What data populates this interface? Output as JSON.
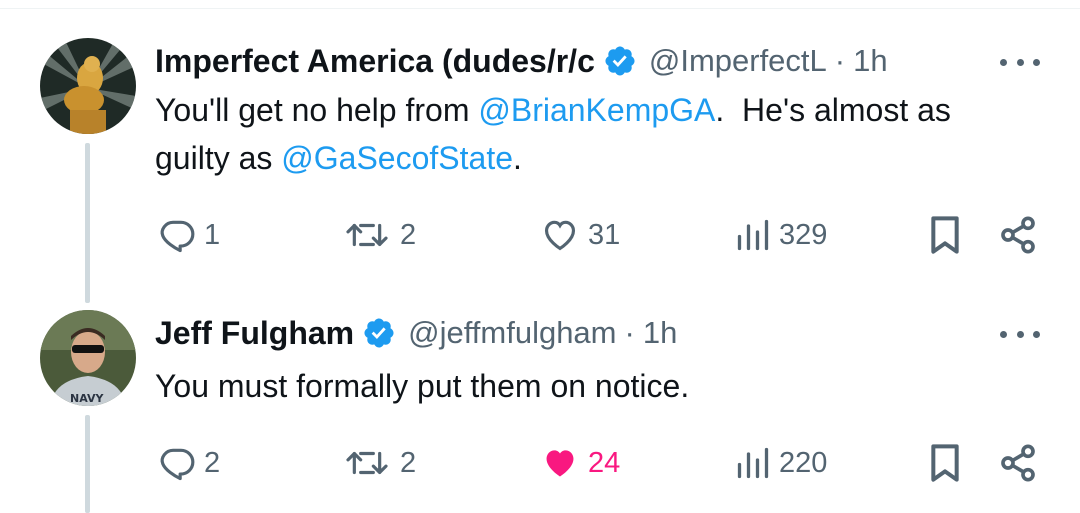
{
  "tweets": [
    {
      "name": "Imperfect America (dudes/r/c",
      "handle": "@ImperfectL",
      "separator": "·",
      "time": "1h",
      "text": {
        "part1": "You'll get no help from ",
        "mention1": "@BrianKempGA",
        "part2": ".  He's almost as",
        "part3": "guilty as ",
        "mention2": "@GaSecofState",
        "part4": "."
      },
      "actions": {
        "replies": "1",
        "reposts": "2",
        "likes": "31",
        "views": "329"
      },
      "liked": false
    },
    {
      "name": "Jeff Fulgham",
      "handle": "@jeffmfulgham",
      "separator": "·",
      "time": "1h",
      "text": {
        "part1": "You must formally put them on notice."
      },
      "actions": {
        "replies": "2",
        "reposts": "2",
        "likes": "24",
        "views": "220"
      },
      "liked": true,
      "avatar_shirt_text": "NAVY"
    }
  ],
  "colors": {
    "mention": "#1d9bf0",
    "muted": "#536471",
    "like_active": "#f91880",
    "verified": "#1d9bf0",
    "thread_line": "#cfd9de"
  }
}
